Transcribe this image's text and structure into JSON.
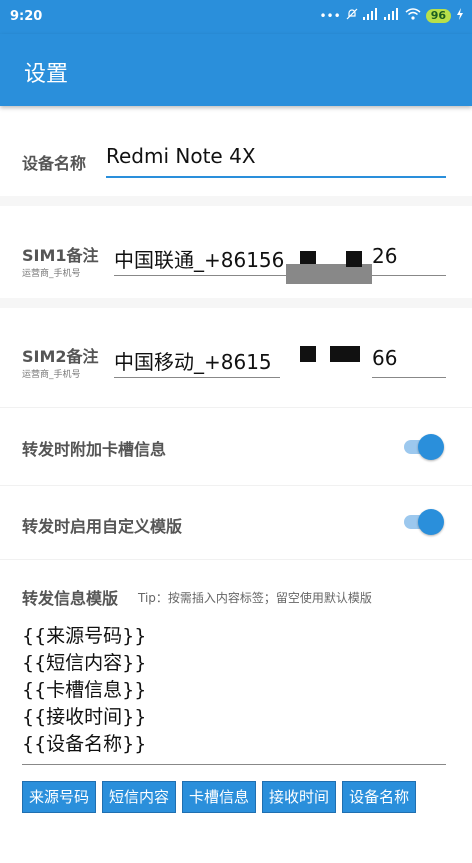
{
  "status_bar": {
    "time": "9:20",
    "icons": [
      "more-dots-icon",
      "mute-icon",
      "signal-icon",
      "signal-icon",
      "wifi-icon",
      "charging-icon"
    ],
    "battery": "96"
  },
  "app_bar": {
    "title": "设置"
  },
  "device_name": {
    "label": "设备名称",
    "value": "Redmi Note 4X"
  },
  "sim1": {
    "label": "SIM1备注",
    "sublabel": "运营商_手机号",
    "value_start": "中国联通_+86156",
    "value_end": "26"
  },
  "sim2": {
    "label": "SIM2备注",
    "sublabel": "运营商_手机号",
    "value_start": "中国移动_+8615",
    "value_end": "66"
  },
  "toggles": [
    {
      "label": "转发时附加卡槽信息",
      "on": true
    },
    {
      "label": "转发时启用自定义模版",
      "on": true
    }
  ],
  "template": {
    "label": "转发信息模版",
    "tip": "Tip：按需插入内容标签；留空使用默认模版",
    "lines": [
      "{{来源号码}}",
      "{{短信内容}}",
      "{{卡槽信息}}",
      "{{接收时间}}",
      "{{设备名称}}"
    ]
  },
  "tag_buttons": [
    "来源号码",
    "短信内容",
    "卡槽信息",
    "接收时间",
    "设备名称"
  ],
  "colors": {
    "accent": "#2a8fdb",
    "battery": "#b8e04a"
  }
}
